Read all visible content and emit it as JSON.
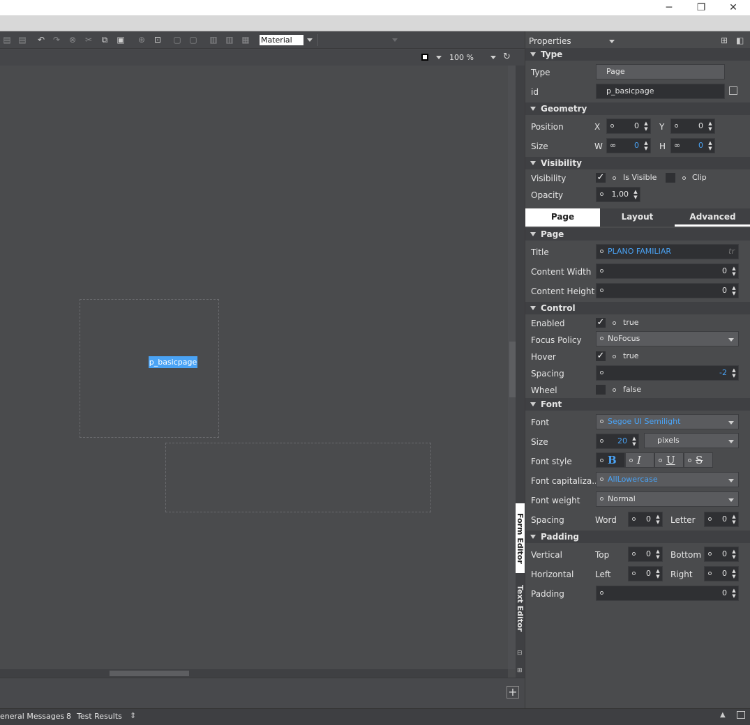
{
  "window": {
    "minimize": "─",
    "restore": "❐",
    "close": "✕"
  },
  "toolbar": {
    "material_select": "Material"
  },
  "viewbar": {
    "zoom": "100 %"
  },
  "canvas": {
    "page_chip": "p_basicpage"
  },
  "side_tabs": {
    "form_editor": "Form Editor",
    "text_editor": "Text Editor"
  },
  "statusbar": {
    "general_messages": "eneral Messages",
    "test_count": "8",
    "test_results": "Test Results"
  },
  "properties": {
    "header": "Properties",
    "type_section": {
      "title": "Type",
      "type_label": "Type",
      "type_value": "Page",
      "id_label": "id",
      "id_value": "p_basicpage"
    },
    "geometry": {
      "title": "Geometry",
      "position_label": "Position",
      "x_label": "X",
      "x_value": "0",
      "y_label": "Y",
      "y_value": "0",
      "size_label": "Size",
      "w_label": "W",
      "w_value": "0",
      "h_label": "H",
      "h_value": "0"
    },
    "visibility": {
      "title": "Visibility",
      "visibility_label": "Visibility",
      "is_visible": "Is Visible",
      "clip": "Clip",
      "opacity_label": "Opacity",
      "opacity_value": "1,00"
    },
    "tabs": {
      "page": "Page",
      "layout": "Layout",
      "advanced": "Advanced"
    },
    "page": {
      "title": "Page",
      "title_label": "Title",
      "title_value": "PLANO FAMILIAR",
      "tr": "tr",
      "content_width_label": "Content Width",
      "content_width": "0",
      "content_height_label": "Content Height",
      "content_height": "0"
    },
    "control": {
      "title": "Control",
      "enabled_label": "Enabled",
      "enabled_value": "true",
      "focus_policy_label": "Focus Policy",
      "focus_policy_value": "NoFocus",
      "hover_label": "Hover",
      "hover_value": "true",
      "spacing_label": "Spacing",
      "spacing_value": "-2",
      "wheel_label": "Wheel",
      "wheel_value": "false"
    },
    "font": {
      "title": "Font",
      "font_label": "Font",
      "font_value": "Segoe UI Semilight",
      "size_label": "Size",
      "size_value": "20",
      "unit_value": "pixels",
      "style_label": "Font style",
      "bold": "B",
      "italic": "I",
      "underline": "U",
      "strike": "S",
      "cap_label": "Font capitaliza...",
      "cap_value": "AllLowercase",
      "weight_label": "Font weight",
      "weight_value": "Normal",
      "spacing_label": "Spacing",
      "word_label": "Word",
      "word_value": "0",
      "letter_label": "Letter",
      "letter_value": "0"
    },
    "padding": {
      "title": "Padding",
      "vertical_label": "Vertical",
      "top_label": "Top",
      "top_value": "0",
      "bottom_label": "Bottom",
      "bottom_value": "0",
      "horizontal_label": "Horizontal",
      "left_label": "Left",
      "left_value": "0",
      "right_label": "Right",
      "right_value": "0",
      "padding_label": "Padding",
      "padding_value": "0"
    }
  },
  "colors": {
    "accent": "#4aa3f5",
    "panel": "#4a4b4d",
    "section": "#3f4043",
    "field": "#2f3033"
  }
}
